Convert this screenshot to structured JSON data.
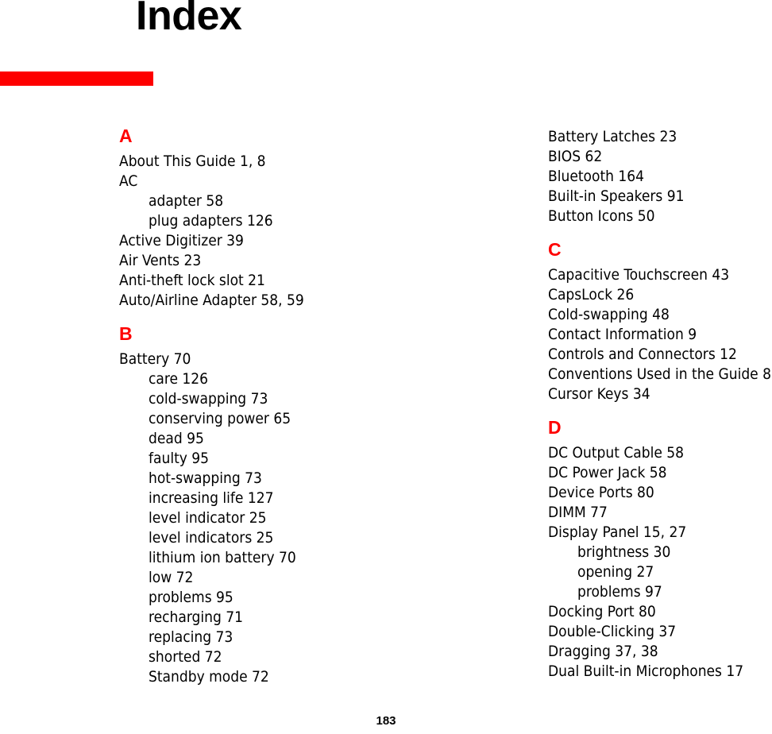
{
  "page": {
    "title": "Index",
    "page_number": "183",
    "accent_color": "#fe0000",
    "text_color": "#000000",
    "background_color": "#ffffff"
  },
  "columns": [
    {
      "name": "left",
      "groups": [
        {
          "letter": "A",
          "entries": [
            {
              "text": "About This Guide 1, 8",
              "level": 0
            },
            {
              "text": "AC",
              "level": 0
            },
            {
              "text": "adapter 58",
              "level": 1
            },
            {
              "text": "plug adapters 126",
              "level": 1
            },
            {
              "text": "Active Digitizer 39",
              "level": 0
            },
            {
              "text": "Air Vents 23",
              "level": 0
            },
            {
              "text": "Anti-theft lock slot 21",
              "level": 0
            },
            {
              "text": "Auto/Airline Adapter 58, 59",
              "level": 0
            }
          ]
        },
        {
          "letter": "B",
          "entries": [
            {
              "text": "Battery 70",
              "level": 0
            },
            {
              "text": "care 126",
              "level": 1
            },
            {
              "text": "cold-swapping 73",
              "level": 1
            },
            {
              "text": "conserving power 65",
              "level": 1
            },
            {
              "text": "dead 95",
              "level": 1
            },
            {
              "text": "faulty 95",
              "level": 1
            },
            {
              "text": "hot-swapping 73",
              "level": 1
            },
            {
              "text": "increasing life 127",
              "level": 1
            },
            {
              "text": "level indicator 25",
              "level": 1
            },
            {
              "text": "level indicators 25",
              "level": 1
            },
            {
              "text": "lithium ion battery 70",
              "level": 1
            },
            {
              "text": "low 72",
              "level": 1
            },
            {
              "text": "problems 95",
              "level": 1
            },
            {
              "text": "recharging 71",
              "level": 1
            },
            {
              "text": "replacing 73",
              "level": 1
            },
            {
              "text": "shorted 72",
              "level": 1
            },
            {
              "text": "Standby mode 72",
              "level": 1
            }
          ]
        }
      ]
    },
    {
      "name": "right",
      "groups": [
        {
          "letter": "",
          "entries": [
            {
              "text": "Battery Latches 23",
              "level": 0
            },
            {
              "text": "BIOS 62",
              "level": 0
            },
            {
              "text": "Bluetooth 164",
              "level": 0
            },
            {
              "text": "Built-in Speakers 91",
              "level": 0
            },
            {
              "text": "Button Icons 50",
              "level": 0
            }
          ]
        },
        {
          "letter": "C",
          "entries": [
            {
              "text": "Capacitive Touchscreen 43",
              "level": 0
            },
            {
              "text": "CapsLock 26",
              "level": 0
            },
            {
              "text": "Cold-swapping 48",
              "level": 0
            },
            {
              "text": "Contact Information 9",
              "level": 0
            },
            {
              "text": "Controls and Connectors 12",
              "level": 0
            },
            {
              "text": "Conventions Used in the Guide 8",
              "level": 0
            },
            {
              "text": "Cursor Keys 34",
              "level": 0
            }
          ]
        },
        {
          "letter": "D",
          "entries": [
            {
              "text": "DC Output Cable 58",
              "level": 0
            },
            {
              "text": "DC Power Jack 58",
              "level": 0
            },
            {
              "text": "Device Ports 80",
              "level": 0
            },
            {
              "text": "DIMM 77",
              "level": 0
            },
            {
              "text": "Display Panel 15, 27",
              "level": 0
            },
            {
              "text": "brightness 30",
              "level": 1
            },
            {
              "text": "opening 27",
              "level": 1
            },
            {
              "text": "problems 97",
              "level": 1
            },
            {
              "text": "Docking Port 80",
              "level": 0
            },
            {
              "text": "Double-Clicking 37",
              "level": 0
            },
            {
              "text": "Dragging 37, 38",
              "level": 0
            },
            {
              "text": "Dual Built-in Microphones 17",
              "level": 0
            }
          ]
        }
      ]
    }
  ]
}
